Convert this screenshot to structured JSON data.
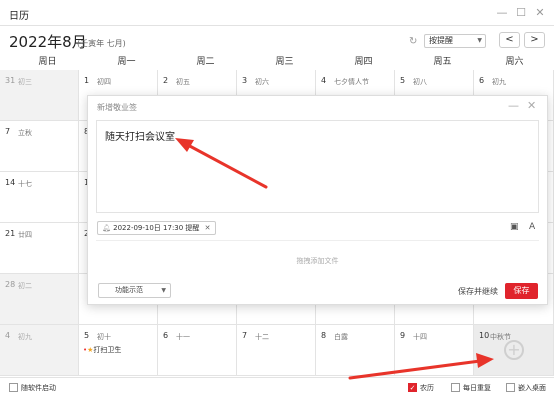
{
  "window": {
    "title": "日历"
  },
  "header": {
    "month_title": "2022年8月",
    "lunar_year": "(壬寅年 七月)",
    "remind_select": "按提醒",
    "prev": "<",
    "next": ">"
  },
  "weekdays": [
    "周日",
    "周一",
    "周二",
    "周三",
    "周四",
    "周五",
    "周六"
  ],
  "rows": [
    [
      {
        "day": "31",
        "lunar": "初三"
      },
      {
        "day": "1",
        "lunar": "初四"
      },
      {
        "day": "2",
        "lunar": "初五"
      },
      {
        "day": "3",
        "lunar": "初六"
      },
      {
        "day": "4",
        "lunar": "七夕情人节"
      },
      {
        "day": "5",
        "lunar": "初八"
      },
      {
        "day": "6",
        "lunar": "初九"
      }
    ],
    [
      {
        "day": "7",
        "lunar": "立秋"
      },
      {
        "day": "8",
        "lunar": ""
      },
      {
        "day": "",
        "lunar": ""
      },
      {
        "day": "",
        "lunar": ""
      },
      {
        "day": "",
        "lunar": ""
      },
      {
        "day": "",
        "lunar": ""
      },
      {
        "day": "",
        "lunar": ""
      }
    ],
    [
      {
        "day": "14",
        "lunar": "十七"
      },
      {
        "day": "1",
        "lunar": ""
      },
      {
        "day": "",
        "lunar": ""
      },
      {
        "day": "",
        "lunar": ""
      },
      {
        "day": "",
        "lunar": ""
      },
      {
        "day": "",
        "lunar": ""
      },
      {
        "day": "",
        "lunar": ""
      }
    ],
    [
      {
        "day": "21",
        "lunar": "廿四"
      },
      {
        "day": "2",
        "lunar": ""
      },
      {
        "day": "",
        "lunar": ""
      },
      {
        "day": "",
        "lunar": ""
      },
      {
        "day": "",
        "lunar": ""
      },
      {
        "day": "",
        "lunar": ""
      },
      {
        "day": "",
        "lunar": ""
      }
    ],
    [
      {
        "day": "28",
        "lunar": "初二"
      },
      {
        "day": "",
        "lunar": ""
      },
      {
        "day": "",
        "lunar": ""
      },
      {
        "day": "",
        "lunar": ""
      },
      {
        "day": "",
        "lunar": ""
      },
      {
        "day": "",
        "lunar": ""
      },
      {
        "day": "",
        "lunar": ""
      }
    ],
    [
      {
        "day": "4",
        "lunar": "初九"
      },
      {
        "day": "5",
        "lunar": "初十"
      },
      {
        "day": "6",
        "lunar": "十一"
      },
      {
        "day": "7",
        "lunar": "十二"
      },
      {
        "day": "8",
        "lunar": "白露"
      },
      {
        "day": "9",
        "lunar": "十四"
      },
      {
        "day": "10",
        "lunar": "中秋节"
      }
    ]
  ],
  "event": {
    "text": "打扫卫生"
  },
  "dialog": {
    "title": "新增敬业签",
    "note_text": "随天打扫会议室",
    "remind_tag": "2022-09-10日 17:30 提醒",
    "drop_hint": "拖拽添加文件",
    "func_select": "功能示范",
    "save_continue": "保存并继续",
    "save": "保存"
  },
  "footer": {
    "auto_start": "随软件启动",
    "lunar": "农历",
    "daily_repeat": "每日重复",
    "embed_desktop": "嵌入桌面"
  },
  "colors": {
    "accent": "#e0242c",
    "arrow": "#e8342a",
    "star": "#f5a623"
  }
}
